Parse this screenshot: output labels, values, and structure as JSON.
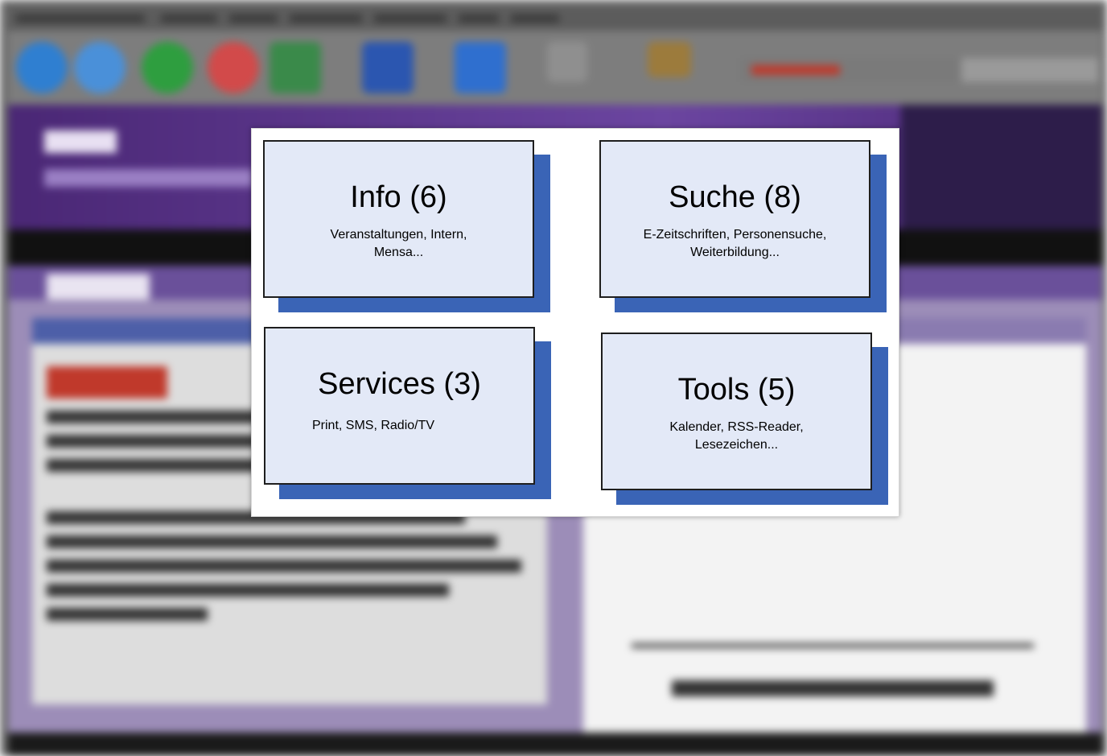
{
  "tiles": {
    "info": {
      "title": "Info (6)",
      "desc_line1": "Veranstaltungen, Intern,",
      "desc_line2": "Mensa..."
    },
    "suche": {
      "title": "Suche (8)",
      "desc_line1": "E-Zeitschriften, Personensuche,",
      "desc_line2": "Weiterbildung..."
    },
    "services": {
      "title": "Services (3)",
      "desc_line1": "Print, SMS, Radio/TV"
    },
    "tools": {
      "title": "Tools (5)",
      "desc_line1": "Kalender, RSS-Reader,",
      "desc_line2": "Lesezeichen..."
    }
  },
  "colors": {
    "tile_face": "#e3e9f7",
    "tile_shadow": "#3a64b6",
    "site_header": "#4a2775"
  }
}
